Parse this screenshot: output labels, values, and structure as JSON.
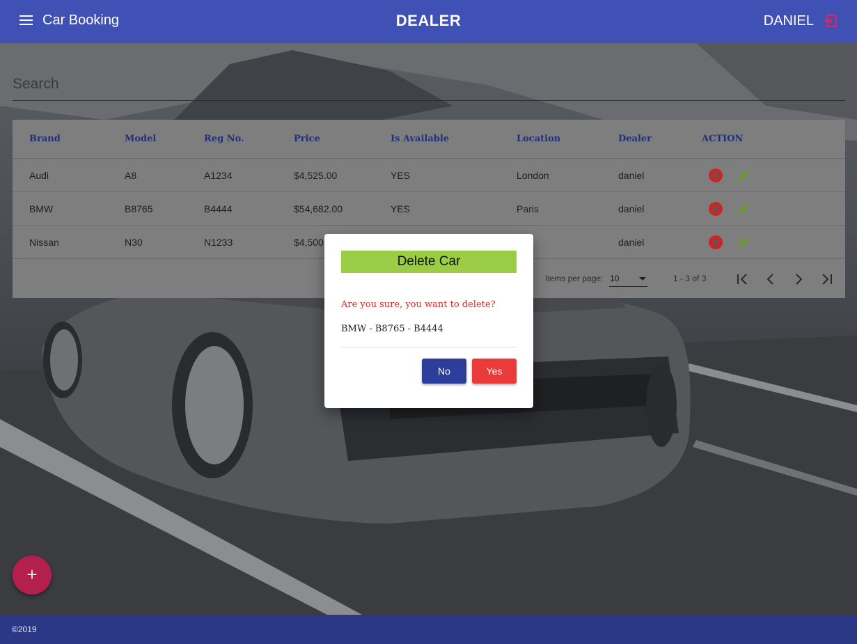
{
  "header": {
    "app_title": "Car Booking",
    "page_title": "DEALER",
    "user_name": "DANIEL"
  },
  "search": {
    "placeholder": "Search"
  },
  "table": {
    "columns": [
      "Brand",
      "Model",
      "Reg No.",
      "Price",
      "Is Available",
      "Location",
      "Dealer",
      "ACTION"
    ],
    "rows": [
      {
        "brand": "Audi",
        "model": "A8",
        "reg": "A1234",
        "price": "$4,525.00",
        "available": "YES",
        "location": "London",
        "dealer": "daniel"
      },
      {
        "brand": "BMW",
        "model": "B8765",
        "reg": "B4444",
        "price": "$54,682.00",
        "available": "YES",
        "location": "Paris",
        "dealer": "daniel"
      },
      {
        "brand": "Nissan",
        "model": "N30",
        "reg": "N1233",
        "price": "$4,500",
        "available": "",
        "location": "don",
        "dealer": "daniel"
      }
    ]
  },
  "paginator": {
    "items_per_page_label": "Items per page:",
    "items_per_page": "10",
    "range": "1 - 3 of 3"
  },
  "fab_label": "+",
  "footer": {
    "copyright": "©2019"
  },
  "dialog": {
    "title": "Delete Car",
    "question": "Are you sure, you want to delete?",
    "item": "BMW - B8765 - B4444",
    "no_label": "No",
    "yes_label": "Yes"
  },
  "colors": {
    "primary": "#3f51b5",
    "footer": "#2a3886",
    "fab": "#b3204f",
    "dialog_title_bg": "#9acc45",
    "delete_red": "#e02424",
    "edit_green": "#7cb342"
  },
  "icons": [
    "menu-icon",
    "logout-icon",
    "delete-icon",
    "edit-icon",
    "first-page-icon",
    "prev-page-icon",
    "next-page-icon",
    "last-page-icon",
    "add-icon"
  ]
}
